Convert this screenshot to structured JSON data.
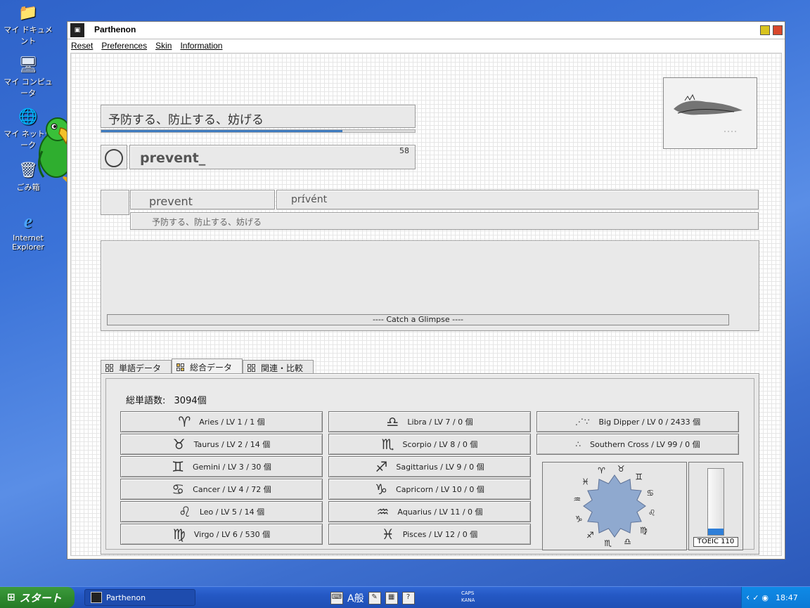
{
  "desktop": {
    "icons": [
      {
        "label": "マイ ドキュメント",
        "glyph": "📁"
      },
      {
        "label": "マイ コンピュータ",
        "glyph": "🖥"
      },
      {
        "label": "マイ ネットワーク",
        "glyph": "🌐"
      },
      {
        "label": "ごみ箱",
        "glyph": "🗑"
      },
      {
        "label": "Internet Explorer",
        "glyph": "e"
      }
    ]
  },
  "window": {
    "title": "Parthenon",
    "menu": [
      "Reset",
      "Preferences",
      "Skin",
      "Information"
    ]
  },
  "quiz": {
    "meaning": "予防する、防止する、妨げる",
    "progress": 0.77,
    "answer": "prevent_",
    "count": "58"
  },
  "entry": {
    "word": "prevent",
    "phonetic": "prɪ́vént",
    "meaning": "予防する、防止する、妨げる"
  },
  "glimpse_label": "----  Catch a Glimpse  ----",
  "tabs": [
    {
      "label": "単語データ",
      "active": false
    },
    {
      "label": "総合データ",
      "active": true
    },
    {
      "label": "関連・比較",
      "active": false
    }
  ],
  "summary": {
    "total_label": "総単語数:",
    "total_value": "3094個"
  },
  "signs": [
    {
      "glyph": "♈",
      "label": "Aries / LV 1 / 1 個"
    },
    {
      "glyph": "♉",
      "label": "Taurus / LV 2 / 14 個"
    },
    {
      "glyph": "♊",
      "label": "Gemini / LV 3 / 30 個"
    },
    {
      "glyph": "♋",
      "label": "Cancer / LV 4 / 72 個"
    },
    {
      "glyph": "♌",
      "label": "Leo / LV 5 / 14 個"
    },
    {
      "glyph": "♍",
      "label": "Virgo / LV 6 / 530 個"
    },
    {
      "glyph": "♎",
      "label": "Libra / LV 7 / 0 個"
    },
    {
      "glyph": "♏",
      "label": "Scorpio / LV 8 / 0 個"
    },
    {
      "glyph": "♐",
      "label": "Sagittarius / LV 9 / 0 個"
    },
    {
      "glyph": "♑",
      "label": "Capricorn / LV 10 / 0 個"
    },
    {
      "glyph": "♒",
      "label": "Aquarius / LV 11 / 0 個"
    },
    {
      "glyph": "♓",
      "label": "Pisces / LV 12 / 0 個"
    }
  ],
  "constellations": [
    {
      "glyph": "⋰∵",
      "label": "Big Dipper / LV 0 / 2433 個"
    },
    {
      "glyph": "∴",
      "label": "Southern Cross / LV 99 / 0 個"
    }
  ],
  "wheel_glyphs": [
    "♈",
    "♉",
    "♊",
    "♋",
    "♌",
    "♍",
    "♎",
    "♏",
    "♐",
    "♑",
    "♒",
    "♓"
  ],
  "toeic": {
    "label": "TOEIC 110",
    "level": 0.1
  },
  "taskbar": {
    "start_label": "スタート",
    "task_label": "Parthenon",
    "ime": "A般",
    "caps": "CAPS",
    "kana": "KANA",
    "clock": "18:47"
  },
  "colors": {
    "progress": "#3f7cc0",
    "wheel_fill": "#8fa9cf",
    "toeic_fill": "#2f7fd8"
  }
}
